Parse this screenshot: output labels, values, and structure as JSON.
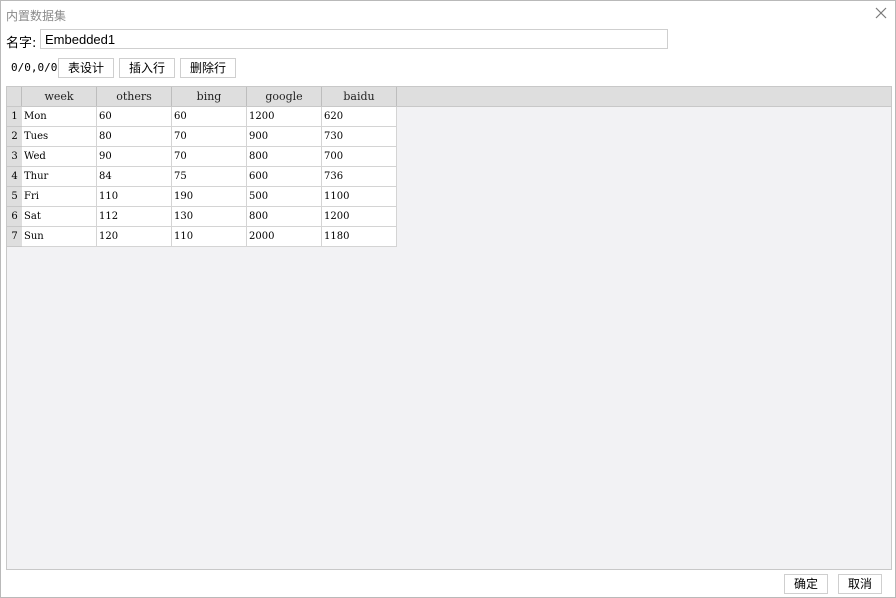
{
  "window": {
    "title": "内置数据集"
  },
  "name_field": {
    "label": "名字:",
    "value": "Embedded1"
  },
  "toolbar": {
    "position": "0/0,0/0",
    "table_design": "表设计",
    "insert_row": "插入行",
    "delete_row": "删除行"
  },
  "table": {
    "columns": [
      "week",
      "others",
      "bing",
      "google",
      "baidu"
    ],
    "rows": [
      {
        "num": "1",
        "cells": [
          "Mon",
          "60",
          "60",
          "1200",
          "620"
        ]
      },
      {
        "num": "2",
        "cells": [
          "Tues",
          "80",
          "70",
          "900",
          "730"
        ]
      },
      {
        "num": "3",
        "cells": [
          "Wed",
          "90",
          "70",
          "800",
          "700"
        ]
      },
      {
        "num": "4",
        "cells": [
          "Thur",
          "84",
          "75",
          "600",
          "736"
        ]
      },
      {
        "num": "5",
        "cells": [
          "Fri",
          "110",
          "190",
          "500",
          "1100"
        ]
      },
      {
        "num": "6",
        "cells": [
          "Sat",
          "112",
          "130",
          "800",
          "1200"
        ]
      },
      {
        "num": "7",
        "cells": [
          "Sun",
          "120",
          "110",
          "2000",
          "1180"
        ]
      }
    ]
  },
  "footer": {
    "ok": "确定",
    "cancel": "取消"
  },
  "icons": {
    "close": "close-icon"
  },
  "colors": {
    "grid_background": "#f2f2f4",
    "header_background": "#dedede",
    "title_text": "#8a8a8a"
  }
}
